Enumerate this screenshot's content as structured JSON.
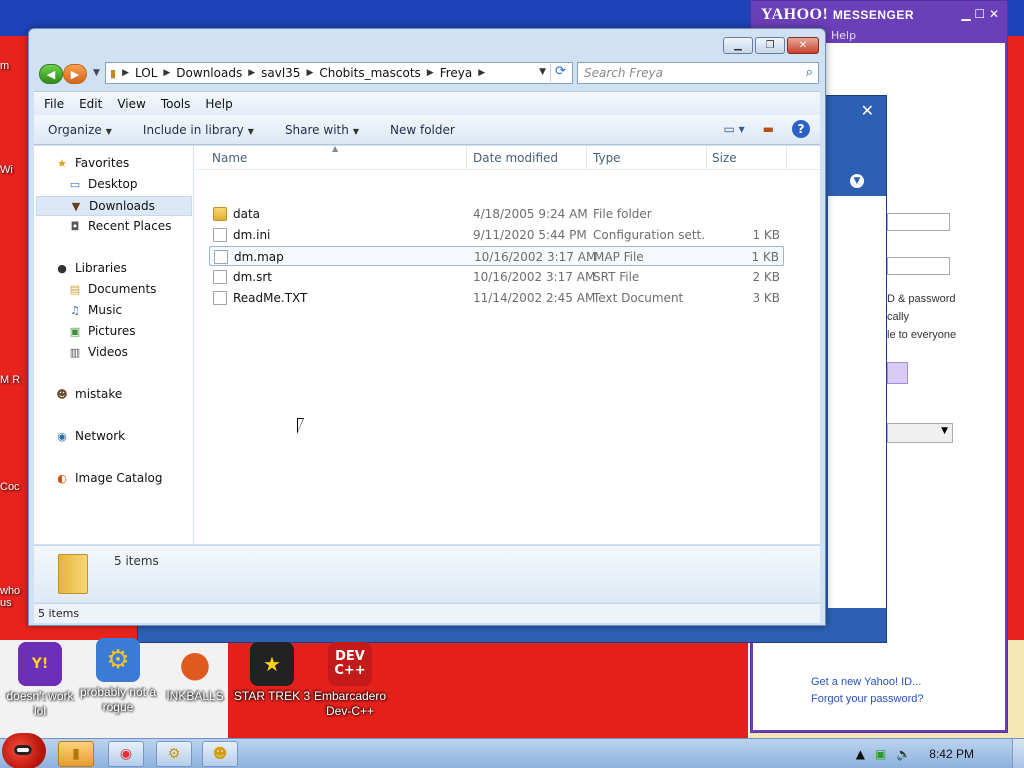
{
  "desktop": {
    "icons": [
      {
        "label": "doesn't work lol",
        "glyph": "Y!",
        "color": "#6b2fb8"
      },
      {
        "label": "probably not a rogue",
        "glyph": "⚙",
        "color": "#3a7bd5"
      },
      {
        "label": "INKBALLS",
        "glyph": "●",
        "color": "#e05a1e"
      },
      {
        "label": "STAR TREK 3",
        "glyph": "★",
        "color": "#222222"
      },
      {
        "label": "Embarcadero Dev-C++",
        "glyph": "DEV C++",
        "color": "#c41a1a"
      }
    ],
    "left_stubs": [
      "m",
      "Wi",
      "M R",
      "Coc",
      "who us"
    ]
  },
  "yahoo": {
    "brand": "YAHOO!",
    "product": "MESSENGER",
    "help": "Help",
    "links": [
      "Get a new Yahoo! ID...",
      "Forgot your password?"
    ]
  },
  "signin_dialog": {
    "close": "✕",
    "texts": [
      "D & password",
      "cally",
      "le to everyone"
    ]
  },
  "explorer": {
    "caption_buttons": {
      "minimize": "▁",
      "maximize": "❐",
      "close": "✕"
    },
    "breadcrumb": [
      "LOL",
      "Downloads",
      "savl35",
      "Chobits_mascots",
      "Freya"
    ],
    "search_placeholder": "Search Freya",
    "menu": [
      "File",
      "Edit",
      "View",
      "Tools",
      "Help"
    ],
    "toolbar": [
      {
        "label": "Organize",
        "dropdown": true
      },
      {
        "label": "Include in library",
        "dropdown": true
      },
      {
        "label": "Share with",
        "dropdown": true
      },
      {
        "label": "New folder",
        "dropdown": false
      }
    ],
    "nav": {
      "favorites": "Favorites",
      "favorites_items": [
        "Desktop",
        "Downloads",
        "Recent Places"
      ],
      "libraries": "Libraries",
      "libraries_items": [
        "Documents",
        "Music",
        "Pictures",
        "Videos"
      ],
      "mistake": "mistake",
      "network": "Network",
      "image_catalog": "Image Catalog",
      "selected": "Downloads"
    },
    "columns": [
      "Name",
      "Date modified",
      "Type",
      "Size"
    ],
    "files": [
      {
        "name": "data",
        "date": "4/18/2005 9:24 AM",
        "type": "File folder",
        "size": "",
        "kind": "folder"
      },
      {
        "name": "dm.ini",
        "date": "9/11/2020 5:44 PM",
        "type": "Configuration sett...",
        "size": "1 KB",
        "kind": "doc"
      },
      {
        "name": "dm.map",
        "date": "10/16/2002 3:17 AM",
        "type": "MAP File",
        "size": "1 KB",
        "kind": "doc",
        "highlighted": true
      },
      {
        "name": "dm.srt",
        "date": "10/16/2002 3:17 AM",
        "type": "SRT File",
        "size": "2 KB",
        "kind": "doc"
      },
      {
        "name": "ReadMe.TXT",
        "date": "11/14/2002 2:45 AM",
        "type": "Text Document",
        "size": "3 KB",
        "kind": "doc"
      }
    ],
    "details_count": "5 items",
    "status": "5 items"
  },
  "taskbar": {
    "clock": "8:42 PM"
  },
  "colors": {
    "wall_red": "#e8231e",
    "wall_blue": "#1e43b8",
    "yahoo_purple": "#6b3fb8",
    "selection": "#dbe8f6"
  }
}
